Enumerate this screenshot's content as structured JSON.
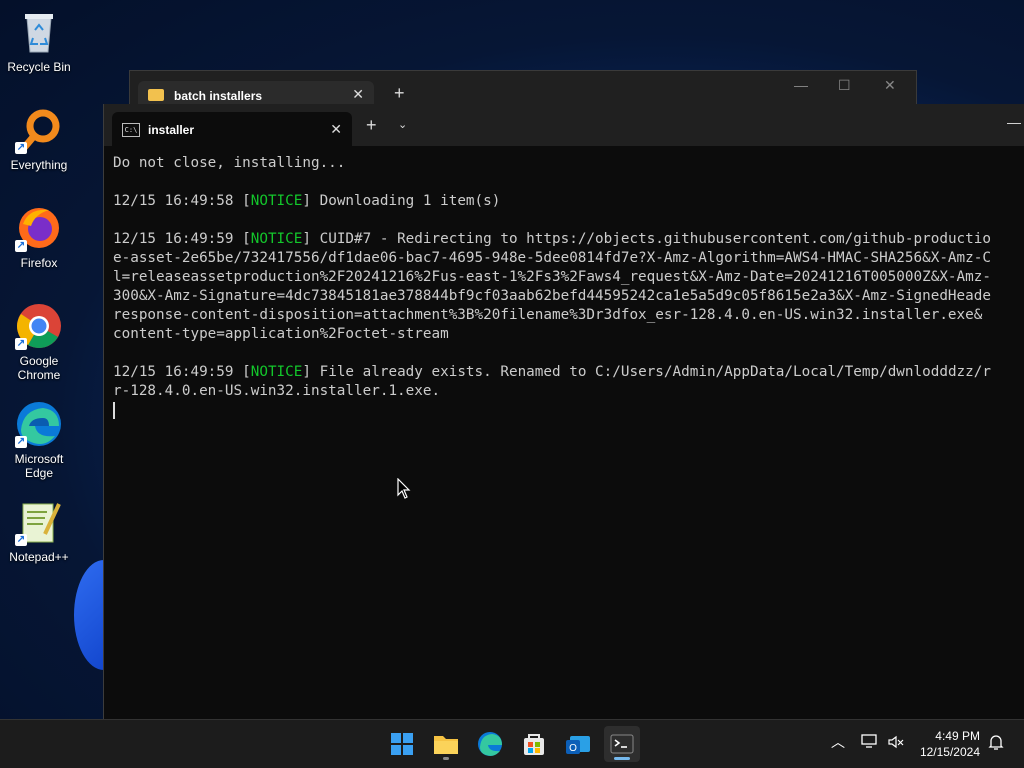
{
  "desktop": {
    "icons": [
      {
        "label": "Recycle Bin"
      },
      {
        "label": "Everything"
      },
      {
        "label": "Firefox"
      },
      {
        "label": "Google Chrome"
      },
      {
        "label": "Microsoft Edge"
      },
      {
        "label": "Notepad++"
      }
    ]
  },
  "explorer_window": {
    "tab_title": "batch installers"
  },
  "terminal": {
    "tab_title": "installer",
    "lines": [
      {
        "pre": "Do not close, installing...",
        "notice": "",
        "post": ""
      },
      {
        "pre": "",
        "notice": "",
        "post": ""
      },
      {
        "pre": "12/15 16:49:58 [",
        "notice": "NOTICE",
        "post": "] Downloading 1 item(s)"
      },
      {
        "pre": "",
        "notice": "",
        "post": ""
      },
      {
        "pre": "12/15 16:49:59 [",
        "notice": "NOTICE",
        "post": "] CUID#7 - Redirecting to https://objects.githubusercontent.com/github-productio"
      },
      {
        "pre": "e-asset-2e65be/732417556/df1dae06-bac7-4695-948e-5dee0814fd7e?X-Amz-Algorithm=AWS4-HMAC-SHA256&X-Amz-C",
        "notice": "",
        "post": ""
      },
      {
        "pre": "l=releaseassetproduction%2F20241216%2Fus-east-1%2Fs3%2Faws4_request&X-Amz-Date=20241216T005000Z&X-Amz-",
        "notice": "",
        "post": ""
      },
      {
        "pre": "300&X-Amz-Signature=4dc73845181ae378844bf9cf03aab62befd44595242ca1e5a5d9c05f8615e2a3&X-Amz-SignedHeade",
        "notice": "",
        "post": ""
      },
      {
        "pre": "response-content-disposition=attachment%3B%20filename%3Dr3dfox_esr-128.4.0.en-US.win32.installer.exe&",
        "notice": "",
        "post": ""
      },
      {
        "pre": "content-type=application%2Foctet-stream",
        "notice": "",
        "post": ""
      },
      {
        "pre": "",
        "notice": "",
        "post": ""
      },
      {
        "pre": "12/15 16:49:59 [",
        "notice": "NOTICE",
        "post": "] File already exists. Renamed to C:/Users/Admin/AppData/Local/Temp/dwnlodddzz/r"
      },
      {
        "pre": "r-128.4.0.en-US.win32.installer.1.exe.",
        "notice": "",
        "post": ""
      }
    ]
  },
  "taskbar": {
    "apps": [
      "start-icon",
      "file-explorer-icon",
      "edge-icon",
      "store-icon",
      "outlook-icon",
      "terminal-icon"
    ],
    "clock_time": "4:49 PM",
    "clock_date": "12/15/2024"
  }
}
